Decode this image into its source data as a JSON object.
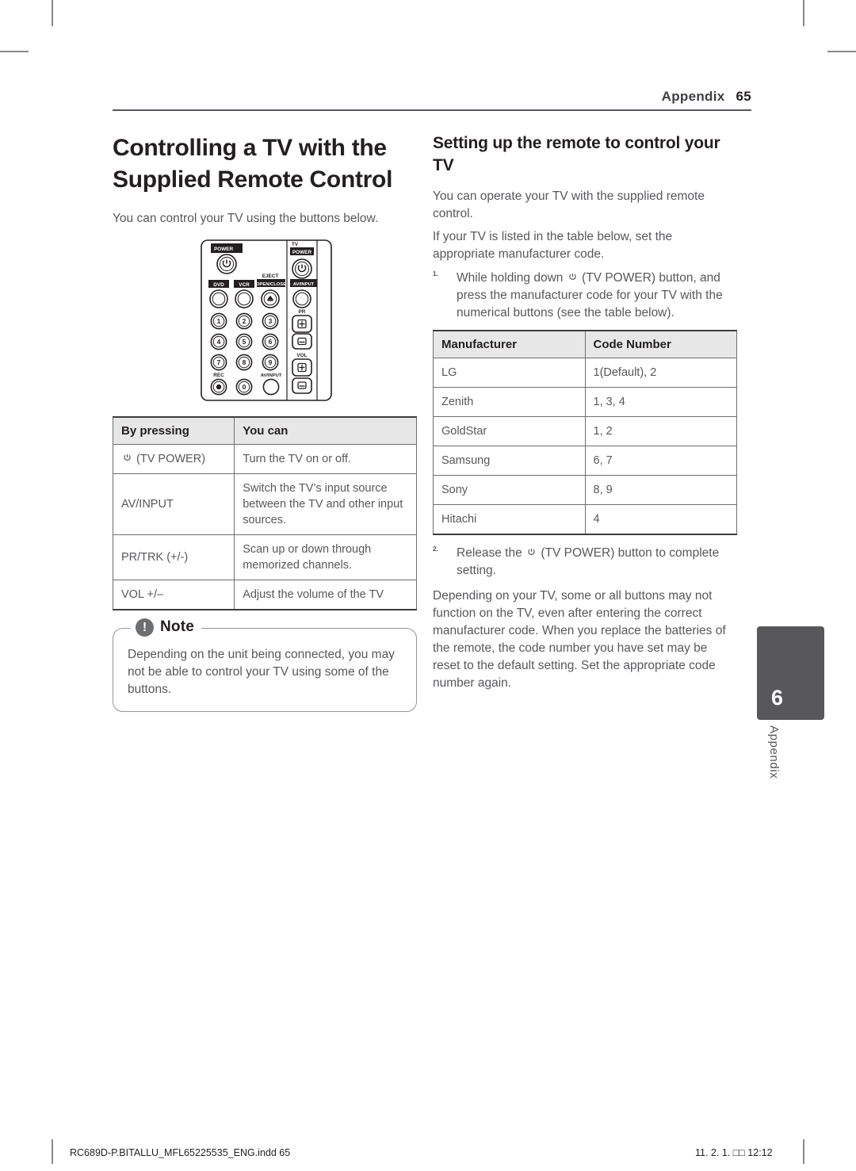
{
  "header": {
    "running_head": "Appendix",
    "page_number": "65"
  },
  "left_column": {
    "heading": "Controlling a TV with the Supplied Remote Control",
    "intro": "You can control your TV using the buttons below.",
    "figure": {
      "name": "remote-control-diagram",
      "labels": {
        "power": "POWER",
        "dvd": "DVD",
        "vcr": "VCR",
        "eject": "EJECT",
        "open_close": "OPEN/CLOSE",
        "tv": "TV",
        "tv_power": "POWER",
        "av_input_top": "AV/INPUT",
        "pr": "PR",
        "vol": "VOL",
        "rec": "REC",
        "av_input_bottom": "AV/INPUT"
      },
      "number_keys": [
        "1",
        "2",
        "3",
        "4",
        "5",
        "6",
        "7",
        "8",
        "9",
        "0"
      ]
    },
    "button_table": {
      "headers": [
        "By pressing",
        "You can"
      ],
      "rows": [
        {
          "button": "(TV POWER)",
          "has_power_icon": true,
          "action": "Turn the TV on or off."
        },
        {
          "button": "AV/INPUT",
          "has_power_icon": false,
          "action": "Switch the TV’s input source between the TV and other input sources."
        },
        {
          "button": "PR/TRK (+/-)",
          "has_power_icon": false,
          "action": "Scan up or down through memorized channels."
        },
        {
          "button": "VOL +/–",
          "has_power_icon": false,
          "action": "Adjust the volume of the TV"
        }
      ]
    },
    "note": {
      "title": "Note",
      "icon": "exclamation-mark",
      "text": "Depending on the unit being connected, you may not be able to control your TV using some of the buttons."
    }
  },
  "right_column": {
    "heading": "Setting up the remote to control your TV",
    "paragraph_1": "You can operate your TV with the supplied remote control.",
    "paragraph_2": "If your TV is listed in the table below, set the appropriate manufacturer code.",
    "steps": [
      {
        "number": "1.",
        "text_before": "While holding down",
        "text_after": "(TV POWER) button, and press the manufacturer code for your TV with the numerical buttons (see the table below)."
      },
      {
        "number": "2.",
        "text_before": "Release the",
        "text_after": "(TV POWER) button to complete setting."
      }
    ],
    "code_table": {
      "headers": [
        "Manufacturer",
        "Code Number"
      ],
      "rows": [
        [
          "LG",
          "1(Default), 2"
        ],
        [
          "Zenith",
          "1, 3, 4"
        ],
        [
          "GoldStar",
          "1, 2"
        ],
        [
          "Samsung",
          "6, 7"
        ],
        [
          "Sony",
          "8, 9"
        ],
        [
          "Hitachi",
          "4"
        ]
      ]
    },
    "closing_paragraph": "Depending on your TV, some or all buttons may not function on the TV, even after entering the correct manufacturer code. When you replace the batteries of the remote, the code number you have set may be reset to the default setting. Set the appropriate code number again."
  },
  "side_tab": {
    "number": "6",
    "label": "Appendix"
  },
  "footer": {
    "left": "RC689D-P.BITALLU_MFL65225535_ENG.indd   65",
    "right": "11. 2. 1.   □□ 12:12"
  },
  "colors": {
    "text": "#231f20",
    "body_text": "#58585b",
    "rule": "#58575f",
    "table_border": "#6d6e71",
    "table_header_bg": "#e7e7e8",
    "tab_bg": "#58585b"
  }
}
